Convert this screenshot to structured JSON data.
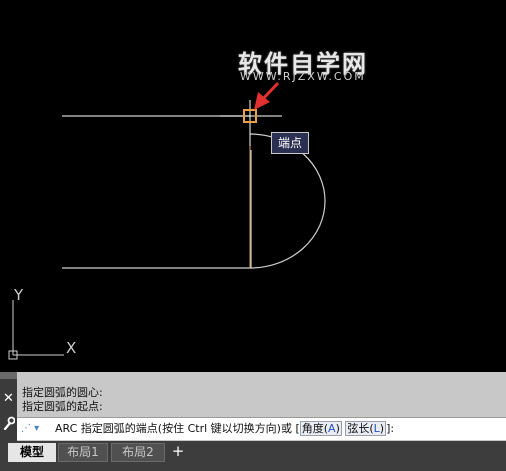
{
  "watermark": {
    "title": "软件自学网",
    "url": "WWW.RJZXW.COM"
  },
  "tooltip": {
    "label": "端点"
  },
  "ucs": {
    "y_label": "Y",
    "x_label": "X"
  },
  "command_history": [
    "指定圆弧的圆心:",
    "指定圆弧的起点:"
  ],
  "command_line": {
    "prompt": "ARC 指定圆弧的端点(按住 Ctrl 键以切换方向)或 [",
    "option1_label": "角度(",
    "option1_key": "A",
    "option1_close": ")",
    "option2_label": "弦长(",
    "option2_key": "L",
    "option2_close": ")",
    "suffix": "]:"
  },
  "tabs": [
    {
      "label": "模型",
      "active": true
    },
    {
      "label": "布局1",
      "active": false
    },
    {
      "label": "布局2",
      "active": false
    }
  ],
  "add_tab_label": "+",
  "colors": {
    "drawing_line": "#cfcfcf",
    "snap_marker": "#e8a040",
    "arrow": "#e03030",
    "tooltip_bg": "#2b2f52"
  }
}
